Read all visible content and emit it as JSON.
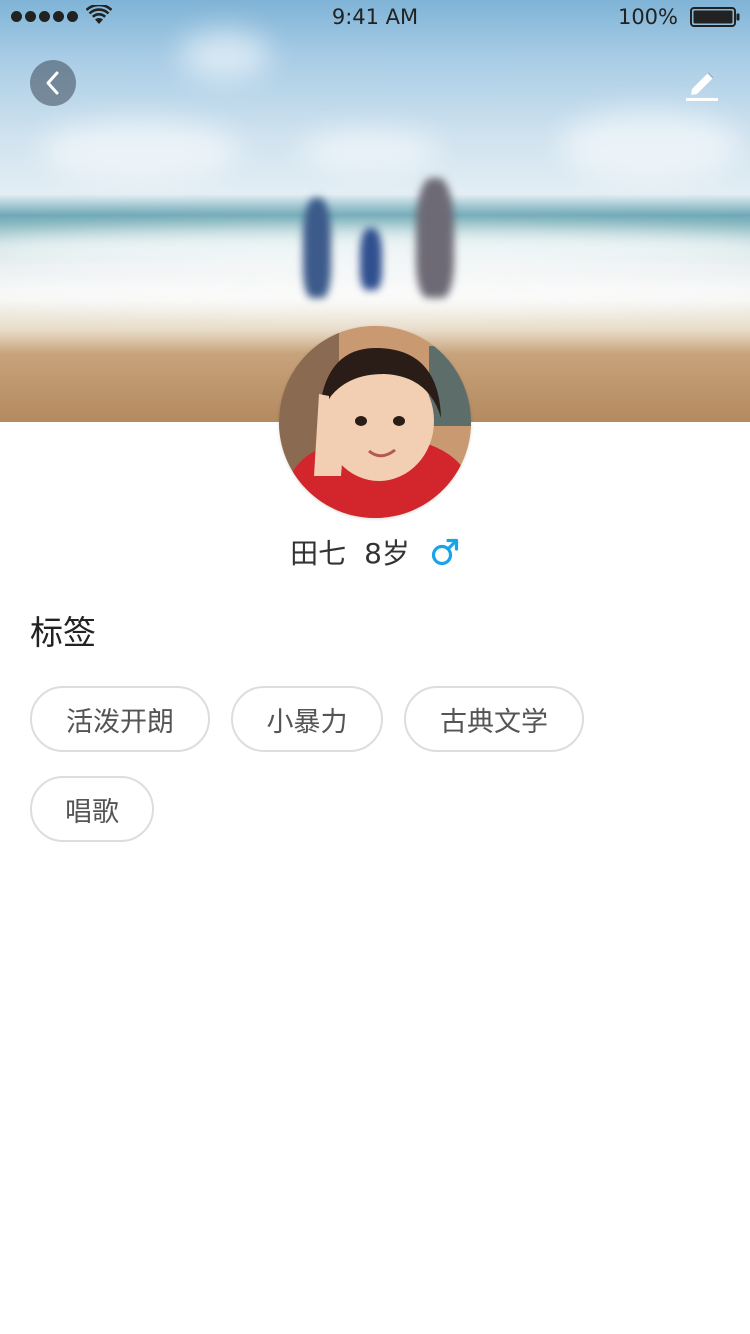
{
  "status_bar": {
    "time": "9:41 AM",
    "battery_percent": "100%",
    "signal_bars": 5,
    "wifi_icon": "wifi-icon",
    "battery_icon": "battery-full-icon"
  },
  "nav": {
    "back_icon": "chevron-left-icon",
    "edit_icon": "pencil-icon"
  },
  "hero": {
    "image_subject": "beach family photo (blurred)"
  },
  "profile": {
    "name": "田七",
    "age": "8岁",
    "gender_icon": "male-icon",
    "gender_color": "#1aa3e8"
  },
  "tags_section": {
    "title": "标签",
    "tags": [
      "活泼开朗",
      "小暴力",
      "古典文学",
      "唱歌"
    ]
  }
}
